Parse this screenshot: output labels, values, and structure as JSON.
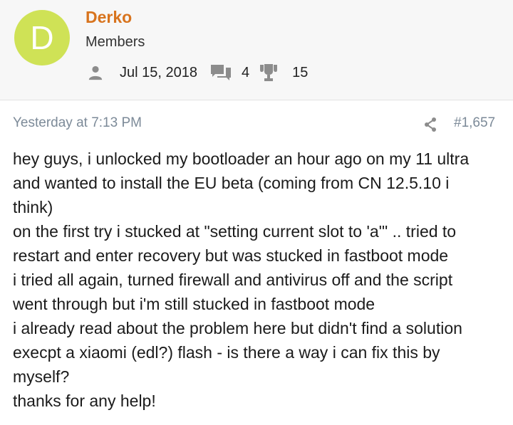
{
  "user": {
    "avatar_letter": "D",
    "avatar_color": "#cfe256",
    "name": "Derko",
    "name_color": "#d8741e",
    "group": "Members",
    "joined": "Jul 15, 2018",
    "messages": "4",
    "trophies": "15",
    "icons": [
      "user-icon",
      "messages-icon",
      "trophy-icon"
    ]
  },
  "post": {
    "date": "Yesterday at 7:13 PM",
    "number": "#1,657",
    "share_icon": "share-icon",
    "lines": [
      "hey guys, i unlocked my bootloader an hour ago on my 11 ultra",
      "and wanted to install the EU beta (coming from CN 12.5.10 i",
      "think)",
      "on the first try i stucked at \"setting current slot to 'a'\" .. tried to",
      "restart and enter recovery but was stucked in fastboot mode",
      "i tried all again, turned firewall and antivirus off and the script",
      "went through but i'm still stucked in fastboot mode",
      "i already read about the problem here but didn't find a solution",
      "execpt a xiaomi (edl?) flash - is there a way i can fix this by",
      "myself?",
      "thanks for any help!"
    ]
  }
}
